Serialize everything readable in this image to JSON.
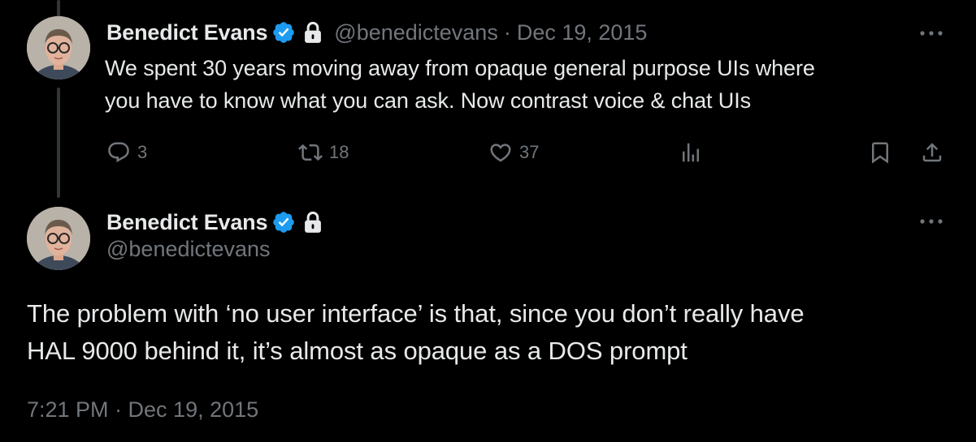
{
  "reply_tweet": {
    "author_name": "Benedict Evans",
    "handle": "@benedictevans",
    "separator": "·",
    "date": "Dec 19, 2015",
    "text_line1": "We spent 30 years moving away from opaque general purpose UIs where",
    "text_line2": "you have to know what you can ask. Now contrast voice & chat UIs",
    "replies": "3",
    "retweets": "18",
    "likes": "37",
    "icons": [
      "verified-badge-icon",
      "lock-icon",
      "more-icon",
      "reply-icon",
      "retweet-icon",
      "like-icon",
      "analytics-icon",
      "bookmark-icon",
      "share-icon"
    ]
  },
  "main_tweet": {
    "author_name": "Benedict Evans",
    "handle": "@benedictevans",
    "text_line1": "The problem with ‘no user interface’ is that, since you don’t really have",
    "text_line2": "HAL 9000 behind it, it’s almost as opaque as a DOS prompt",
    "timestamp": "7:21 PM · Dec 19, 2015"
  },
  "colors": {
    "background": "#000000",
    "text_primary": "#e7e9ea",
    "text_secondary": "#71767b",
    "verified_blue": "#1d9bf0",
    "thread_line": "#333639"
  }
}
